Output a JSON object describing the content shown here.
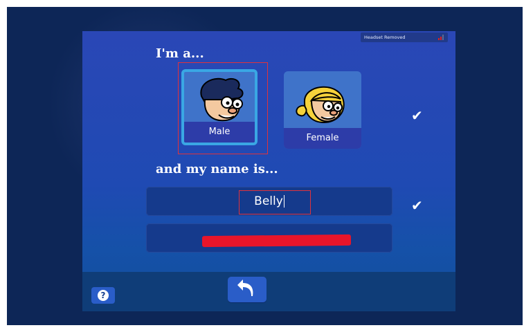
{
  "status": {
    "text": "Headset Removed"
  },
  "gender": {
    "heading": "I'm a...",
    "options": [
      {
        "label": "Male",
        "selected": true
      },
      {
        "label": "Female",
        "selected": false
      }
    ]
  },
  "name": {
    "heading": "and my name is...",
    "first_value": "Belly",
    "second_value": ""
  },
  "icons": {
    "check": "✔",
    "back": "return-arrow-icon",
    "help": "?"
  },
  "colors": {
    "selection_outline": "#e0323c",
    "male_card_border": "#3aa7e4",
    "panel": "#2a47b6"
  }
}
